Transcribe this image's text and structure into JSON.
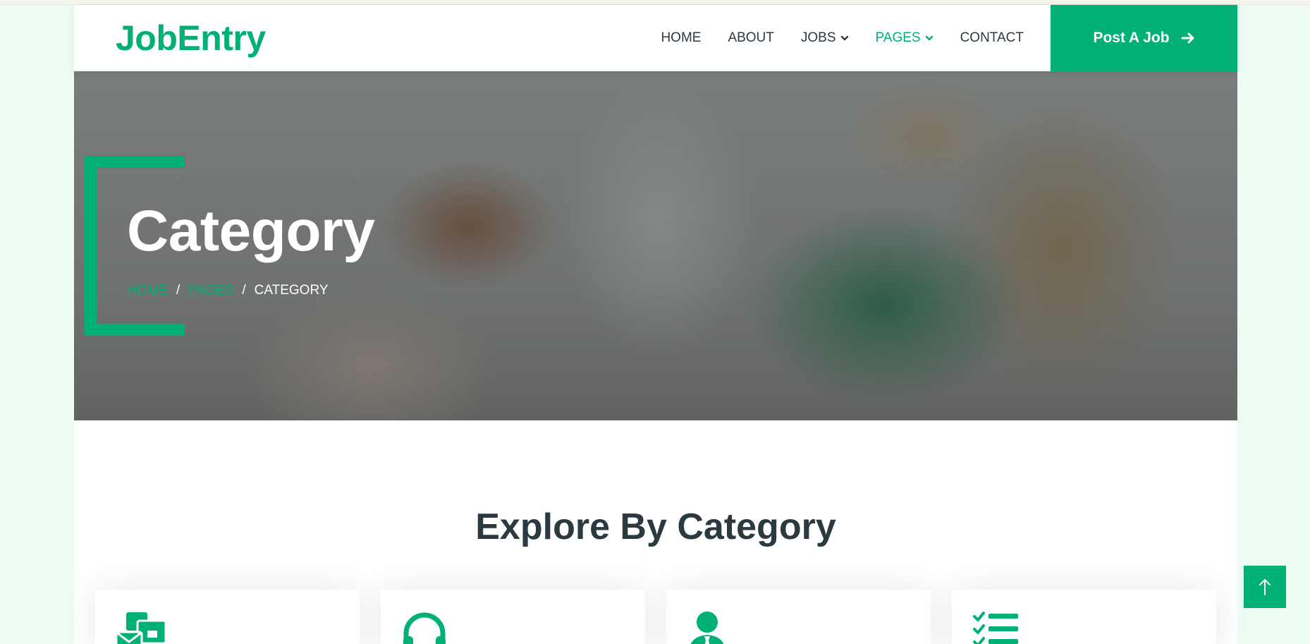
{
  "brand": {
    "name": "JobEntry"
  },
  "nav": {
    "items": [
      {
        "label": "HOME",
        "dropdown": false,
        "active": false
      },
      {
        "label": "ABOUT",
        "dropdown": false,
        "active": false
      },
      {
        "label": "JOBS",
        "dropdown": true,
        "active": false
      },
      {
        "label": "PAGES",
        "dropdown": true,
        "active": true
      },
      {
        "label": "CONTACT",
        "dropdown": false,
        "active": false
      }
    ],
    "cta_label": "Post A Job",
    "cta_icon": "arrow-right-icon"
  },
  "hero": {
    "title": "Category",
    "breadcrumb": [
      {
        "label": "HOME",
        "link": true
      },
      {
        "label": "PAGES",
        "link": true
      },
      {
        "label": "CATEGORY",
        "link": false
      }
    ]
  },
  "section": {
    "title": "Explore By Category"
  },
  "cards": [
    {
      "icon": "mail-bulk-icon"
    },
    {
      "icon": "headset-icon"
    },
    {
      "icon": "user-tie-icon"
    },
    {
      "icon": "tasks-list-icon"
    }
  ],
  "back_to_top": {
    "icon": "arrow-up-icon"
  },
  "colors": {
    "accent": "#00b074",
    "text_dark": "#2b3940",
    "page_bg": "#eefbf3"
  }
}
